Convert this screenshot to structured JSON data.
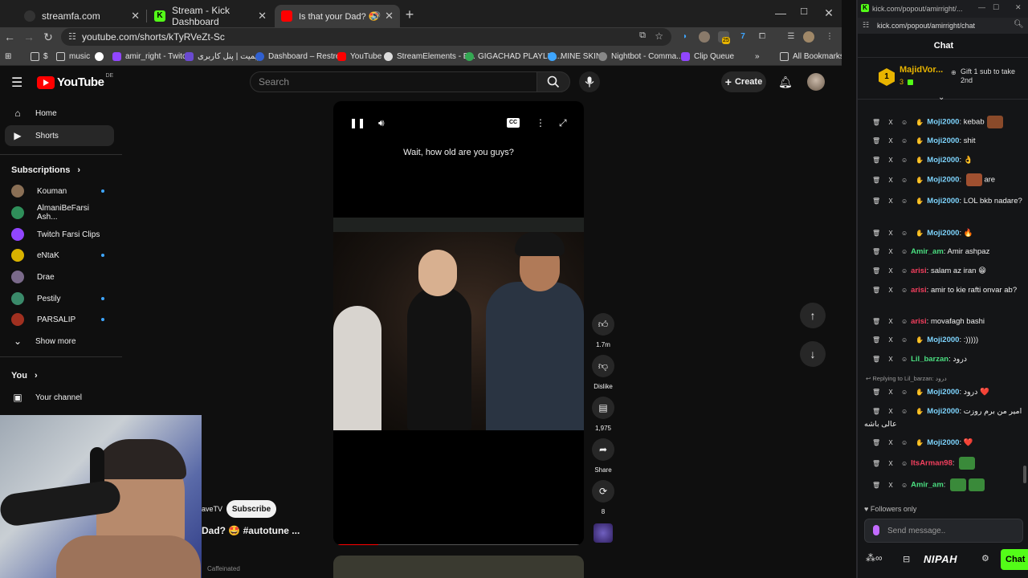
{
  "browser": {
    "tabs": [
      {
        "title": "streamfa.com",
        "active": false
      },
      {
        "title": "Stream - Kick Dashboard",
        "active": false
      },
      {
        "title": "Is that your Dad? 🤩 #autot",
        "active": true
      }
    ],
    "url": "youtube.com/shorts/kTyRVeZt-Sc",
    "bookmarks": [
      "$",
      "music",
      "amir_right - Twitch",
      "ریمیت | پنل کاربری",
      "Dashboard – Restre...",
      "YouTube",
      "StreamElements - B...",
      "GIGACHAD PLAYLIS...",
      "MINE SKIN",
      "Nightbot - Comma...",
      "Clip Queue"
    ],
    "all_bookmarks": "All Bookmarks",
    "ext_badge": "25"
  },
  "youtube": {
    "logo_text": "YouTube",
    "country": "DE",
    "search_placeholder": "Search",
    "create_label": "Create",
    "nav": {
      "home": "Home",
      "shorts": "Shorts"
    },
    "subscriptions_label": "Subscriptions",
    "subscriptions": [
      {
        "name": "Kouman",
        "dot": true,
        "color": "#8a6f55"
      },
      {
        "name": "AlmaniBeFarsi Ash...",
        "dot": false,
        "color": "#2f8f5a"
      },
      {
        "name": "Twitch Farsi Clips",
        "dot": false,
        "color": "#9146ff"
      },
      {
        "name": "eNtaK",
        "dot": true,
        "color": "#d9b300"
      },
      {
        "name": "Drae",
        "dot": false,
        "color": "#7a6a8a"
      },
      {
        "name": "Pestily",
        "dot": true,
        "color": "#3a8a6a"
      },
      {
        "name": "PARSALIP",
        "dot": true,
        "color": "#a03020"
      }
    ],
    "show_more": "Show more",
    "you_label": "You",
    "your_channel": "Your channel",
    "short": {
      "caption": "Wait, how old are you guys?",
      "likes": "1.7m",
      "dislike": "Dislike",
      "comments": "1,975",
      "share": "Share",
      "remix": "8",
      "channel": "aveTV",
      "subscribe": "Subscribe",
      "title": "Dad? 🤩  #autotune ...",
      "progress": 0.17,
      "overlay_text": "Caffeinated"
    }
  },
  "kick": {
    "window_title": "kick.com/popout/amirright/...",
    "url": "kick.com/popout/amirright/chat",
    "chat_header": "Chat",
    "gifter": {
      "name": "MajidVor...",
      "rank": "1",
      "count": "3",
      "gift_text": "Gift 1 sub to take 2nd"
    },
    "messages": [
      {
        "user": "Moji2000",
        "color": "#7dd3fc",
        "text": "kebab",
        "emote": "#8a4a2a"
      },
      {
        "user": "Moji2000",
        "color": "#7dd3fc",
        "text": "shit",
        "emote": ""
      },
      {
        "user": "Moji2000",
        "color": "#7dd3fc",
        "text": "👌",
        "emote": ""
      },
      {
        "user": "Moji2000",
        "color": "#7dd3fc",
        "text": "are",
        "emote": "#a05030"
      },
      {
        "user": "Moji2000",
        "color": "#7dd3fc",
        "text": "LOL bkb nadare?",
        "emote": ""
      },
      {
        "user": "Moji2000",
        "color": "#7dd3fc",
        "text": "🔥",
        "emote": ""
      },
      {
        "user": "Amir_am",
        "color": "#4ade80",
        "text": "Amir ashpaz",
        "emote": ""
      },
      {
        "user": "arisi",
        "color": "#f43f5e",
        "text": "salam az iran 😁",
        "emote": ""
      },
      {
        "user": "arisi",
        "color": "#f43f5e",
        "text": "amir to kie rafti onvar ab?",
        "emote": ""
      },
      {
        "user": "arisi",
        "color": "#f43f5e",
        "text": "movafagh bashi",
        "emote": ""
      },
      {
        "user": "Moji2000",
        "color": "#7dd3fc",
        "text": ":)))))",
        "emote": ""
      },
      {
        "user": "Lil_barzan",
        "color": "#4ade80",
        "text": "درود",
        "emote": ""
      },
      {
        "user": "Moji2000",
        "color": "#7dd3fc",
        "text": "درود ❤️",
        "emote": "",
        "reply": "Replying to Lil_barzan: درود"
      },
      {
        "user": "Moji2000",
        "color": "#7dd3fc",
        "text": "امیر من برم روزت عالی باشه",
        "emote": ""
      },
      {
        "user": "Moji2000",
        "color": "#7dd3fc",
        "text": "❤️",
        "emote": ""
      },
      {
        "user": "ItsArman98",
        "color": "#f43f5e",
        "text": "",
        "emote": "#3a8a3a"
      },
      {
        "user": "Amir_am",
        "color": "#4ade80",
        "text": "",
        "emote": "#3a8a3a"
      }
    ],
    "followers_only": "Followers only",
    "send_placeholder": "Send message..",
    "bottom_label": "NIPAH",
    "chat_button": "Chat"
  }
}
